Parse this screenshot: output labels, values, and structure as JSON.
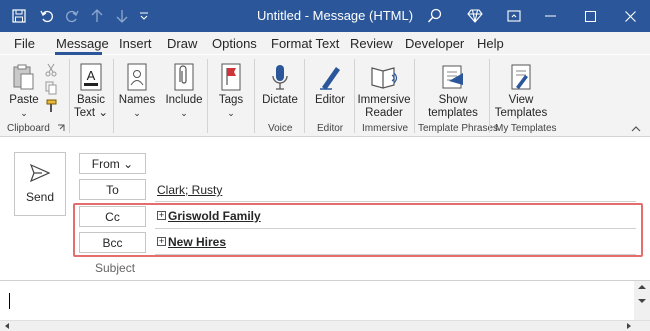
{
  "window": {
    "title": "Untitled  -  Message (HTML)"
  },
  "tabs": [
    "File",
    "Message",
    "Insert",
    "Draw",
    "Options",
    "Format Text",
    "Review",
    "Developer",
    "Help"
  ],
  "ribbon": {
    "clipboard": {
      "paste": "Paste",
      "group": "Clipboard"
    },
    "basic_text": {
      "line1": "Basic",
      "line2": "Text ⌄"
    },
    "names": "Names",
    "include": "Include",
    "tags": "Tags",
    "voice": {
      "dictate": "Dictate",
      "group": "Voice"
    },
    "editor": {
      "label": "Editor",
      "group": "Editor"
    },
    "immersive": {
      "line1": "Immersive",
      "line2": "Reader",
      "group": "Immersive"
    },
    "templates": {
      "line1": "Show",
      "line2": "templates",
      "group": "Template Phrases"
    },
    "my_templates": {
      "line1": "View",
      "line2": "Templates",
      "group": "My Templates"
    }
  },
  "compose": {
    "send": "Send",
    "from": "From ⌄",
    "to": "To",
    "cc": "Cc",
    "bcc": "Bcc",
    "to_value": "Clark; Rusty",
    "cc_value": "Griswold Family",
    "bcc_value": "New Hires",
    "subject_placeholder": "Subject"
  }
}
